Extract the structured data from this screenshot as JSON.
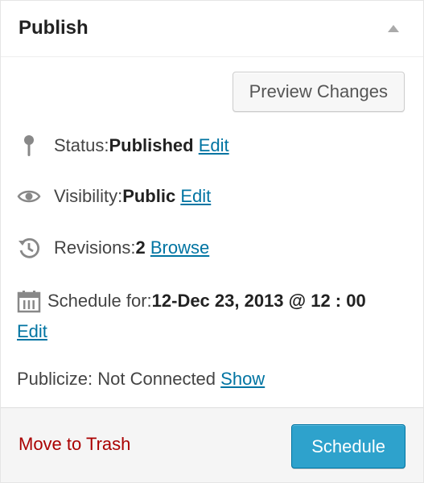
{
  "panel": {
    "title": "Publish",
    "toggle_icon": "arrow-up-icon"
  },
  "preview_button": {
    "label": "Preview Changes"
  },
  "status": {
    "icon": "pin-icon",
    "label": "Status: ",
    "value": "Published",
    "link": "Edit"
  },
  "visibility": {
    "icon": "eye-icon",
    "label": "Visibility: ",
    "value": "Public",
    "link": "Edit"
  },
  "revisions": {
    "icon": "history-icon",
    "label": "Revisions: ",
    "value": "2",
    "link": "Browse"
  },
  "schedule": {
    "icon": "calendar-icon",
    "label": "Schedule for: ",
    "value": "12-Dec 23, 2013 @ 12 : 00",
    "link": "Edit"
  },
  "publicize": {
    "label": "Publicize: Not Connected ",
    "link": "Show"
  },
  "footer": {
    "trash_link": "Move to Trash",
    "schedule_button": "Schedule"
  },
  "colors": {
    "link": "#0074a2",
    "trash": "#aa0000",
    "primary_button": "#2ea2cc"
  }
}
